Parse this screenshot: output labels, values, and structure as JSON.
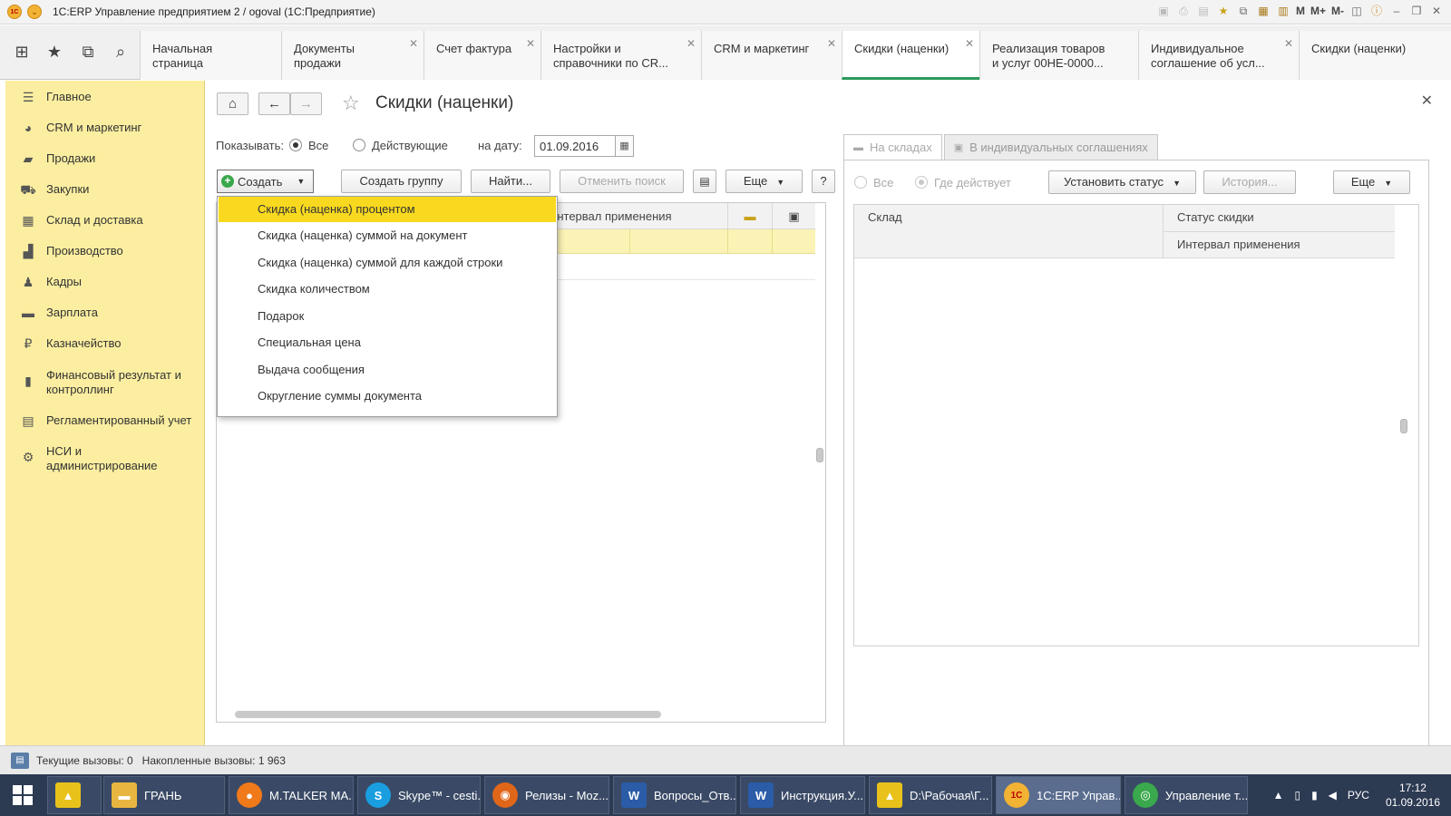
{
  "window": {
    "title": "1С:ERP Управление предприятием 2 / ogoval  (1С:Предприятие)",
    "logo_text": "1С",
    "right_texts": [
      "M",
      "M+",
      "M-"
    ]
  },
  "section_tabs": [
    {
      "label": "Начальная страница",
      "closable": false
    },
    {
      "label": "Документы продажи",
      "closable": true
    },
    {
      "label": "Счет фактура",
      "closable": true
    },
    {
      "label": "Настройки и\nсправочники по CR...",
      "closable": true
    },
    {
      "label": "CRM и маркетинг",
      "closable": true
    },
    {
      "label": "Скидки (наценки)",
      "closable": true,
      "active": true
    },
    {
      "label": "Реализация товаров\nи услуг 00НЕ-0000...",
      "closable": false
    },
    {
      "label": "Индивидуальное\nсоглашение об усл...",
      "closable": true
    },
    {
      "label": "Скидки (наценки)",
      "closable": false
    }
  ],
  "sidebar": {
    "items": [
      {
        "label": "Главное",
        "icon": "menu-icon"
      },
      {
        "label": "CRM и маркетинг",
        "icon": "pie-chart-icon"
      },
      {
        "label": "Продажи",
        "icon": "bag-icon"
      },
      {
        "label": "Закупки",
        "icon": "cart-icon"
      },
      {
        "label": "Склад и доставка",
        "icon": "warehouse-icon"
      },
      {
        "label": "Производство",
        "icon": "factory-icon"
      },
      {
        "label": "Кадры",
        "icon": "person-icon"
      },
      {
        "label": "Зарплата",
        "icon": "wallet-icon"
      },
      {
        "label": "Казначейство",
        "icon": "ruble-icon"
      },
      {
        "label": "Финансовый результат и\nконтроллинг",
        "icon": "bar-chart-icon"
      },
      {
        "label": "Регламентированный учет",
        "icon": "ledger-icon"
      },
      {
        "label": "НСИ и\nадминистрирование",
        "icon": "gear-icon"
      }
    ]
  },
  "form": {
    "title": "Скидки (наценки)",
    "show_label": "Показывать:",
    "radio_all": "Все",
    "radio_active": "Действующие",
    "date_label": "на дату:",
    "date_value": "01.09.2016",
    "toolbar": {
      "create": "Создать",
      "create_group": "Создать группу",
      "find": "Найти...",
      "cancel_search": "Отменить поиск",
      "more": "Еще",
      "help": "?"
    },
    "table_header_interval": "Интервал применения",
    "create_menu": [
      "Скидка (наценка) процентом",
      "Скидка (наценка) суммой на документ",
      "Скидка (наценка) суммой для каждой строки",
      "Скидка количеством",
      "Подарок",
      "Специальная цена",
      "Выдача сообщения",
      "Округление суммы документа"
    ]
  },
  "right_panel": {
    "tab_warehouses": "На складах",
    "tab_agreements": "В индивидуальных соглашениях",
    "radio_all": "Все",
    "radio_where": "Где действует",
    "set_status": "Установить статус",
    "history": "История...",
    "more": "Еще",
    "col_warehouse": "Склад",
    "col_status": "Статус скидки",
    "col_interval": "Интервал применения"
  },
  "statusbar": {
    "text": "Текущие вызовы: 0   Накопленные вызовы: 1 963"
  },
  "taskbar": {
    "items": [
      {
        "label": "",
        "color": "#e8c21a",
        "icon": "triangle-app-icon"
      },
      {
        "label": "ГРАНЬ",
        "color": "#e8b640",
        "icon": "folder-icon"
      },
      {
        "label": "M.TALKER MA...",
        "color": "#f07a1a",
        "icon": "app-icon"
      },
      {
        "label": "Skype™ - cesti...",
        "color": "#1a9ee0",
        "icon": "skype-icon"
      },
      {
        "label": "Релизы - Moz...",
        "color": "#e0661a",
        "icon": "firefox-icon"
      },
      {
        "label": "Вопросы_Отв...",
        "color": "#2a5ca8",
        "icon": "word-icon"
      },
      {
        "label": "Инструкция.У...",
        "color": "#2a5ca8",
        "icon": "word-icon"
      },
      {
        "label": "D:\\Рабочая\\Г...",
        "color": "#e8c21a",
        "icon": "triangle-app-icon"
      },
      {
        "label": "1С:ERP Управ...",
        "color": "#f2b233",
        "icon": "1c-icon"
      },
      {
        "label": "Управление т...",
        "color": "#3aa84c",
        "icon": "chrome-icon"
      }
    ],
    "lang": "РУС",
    "time": "17:12",
    "date": "01.09.2016"
  }
}
